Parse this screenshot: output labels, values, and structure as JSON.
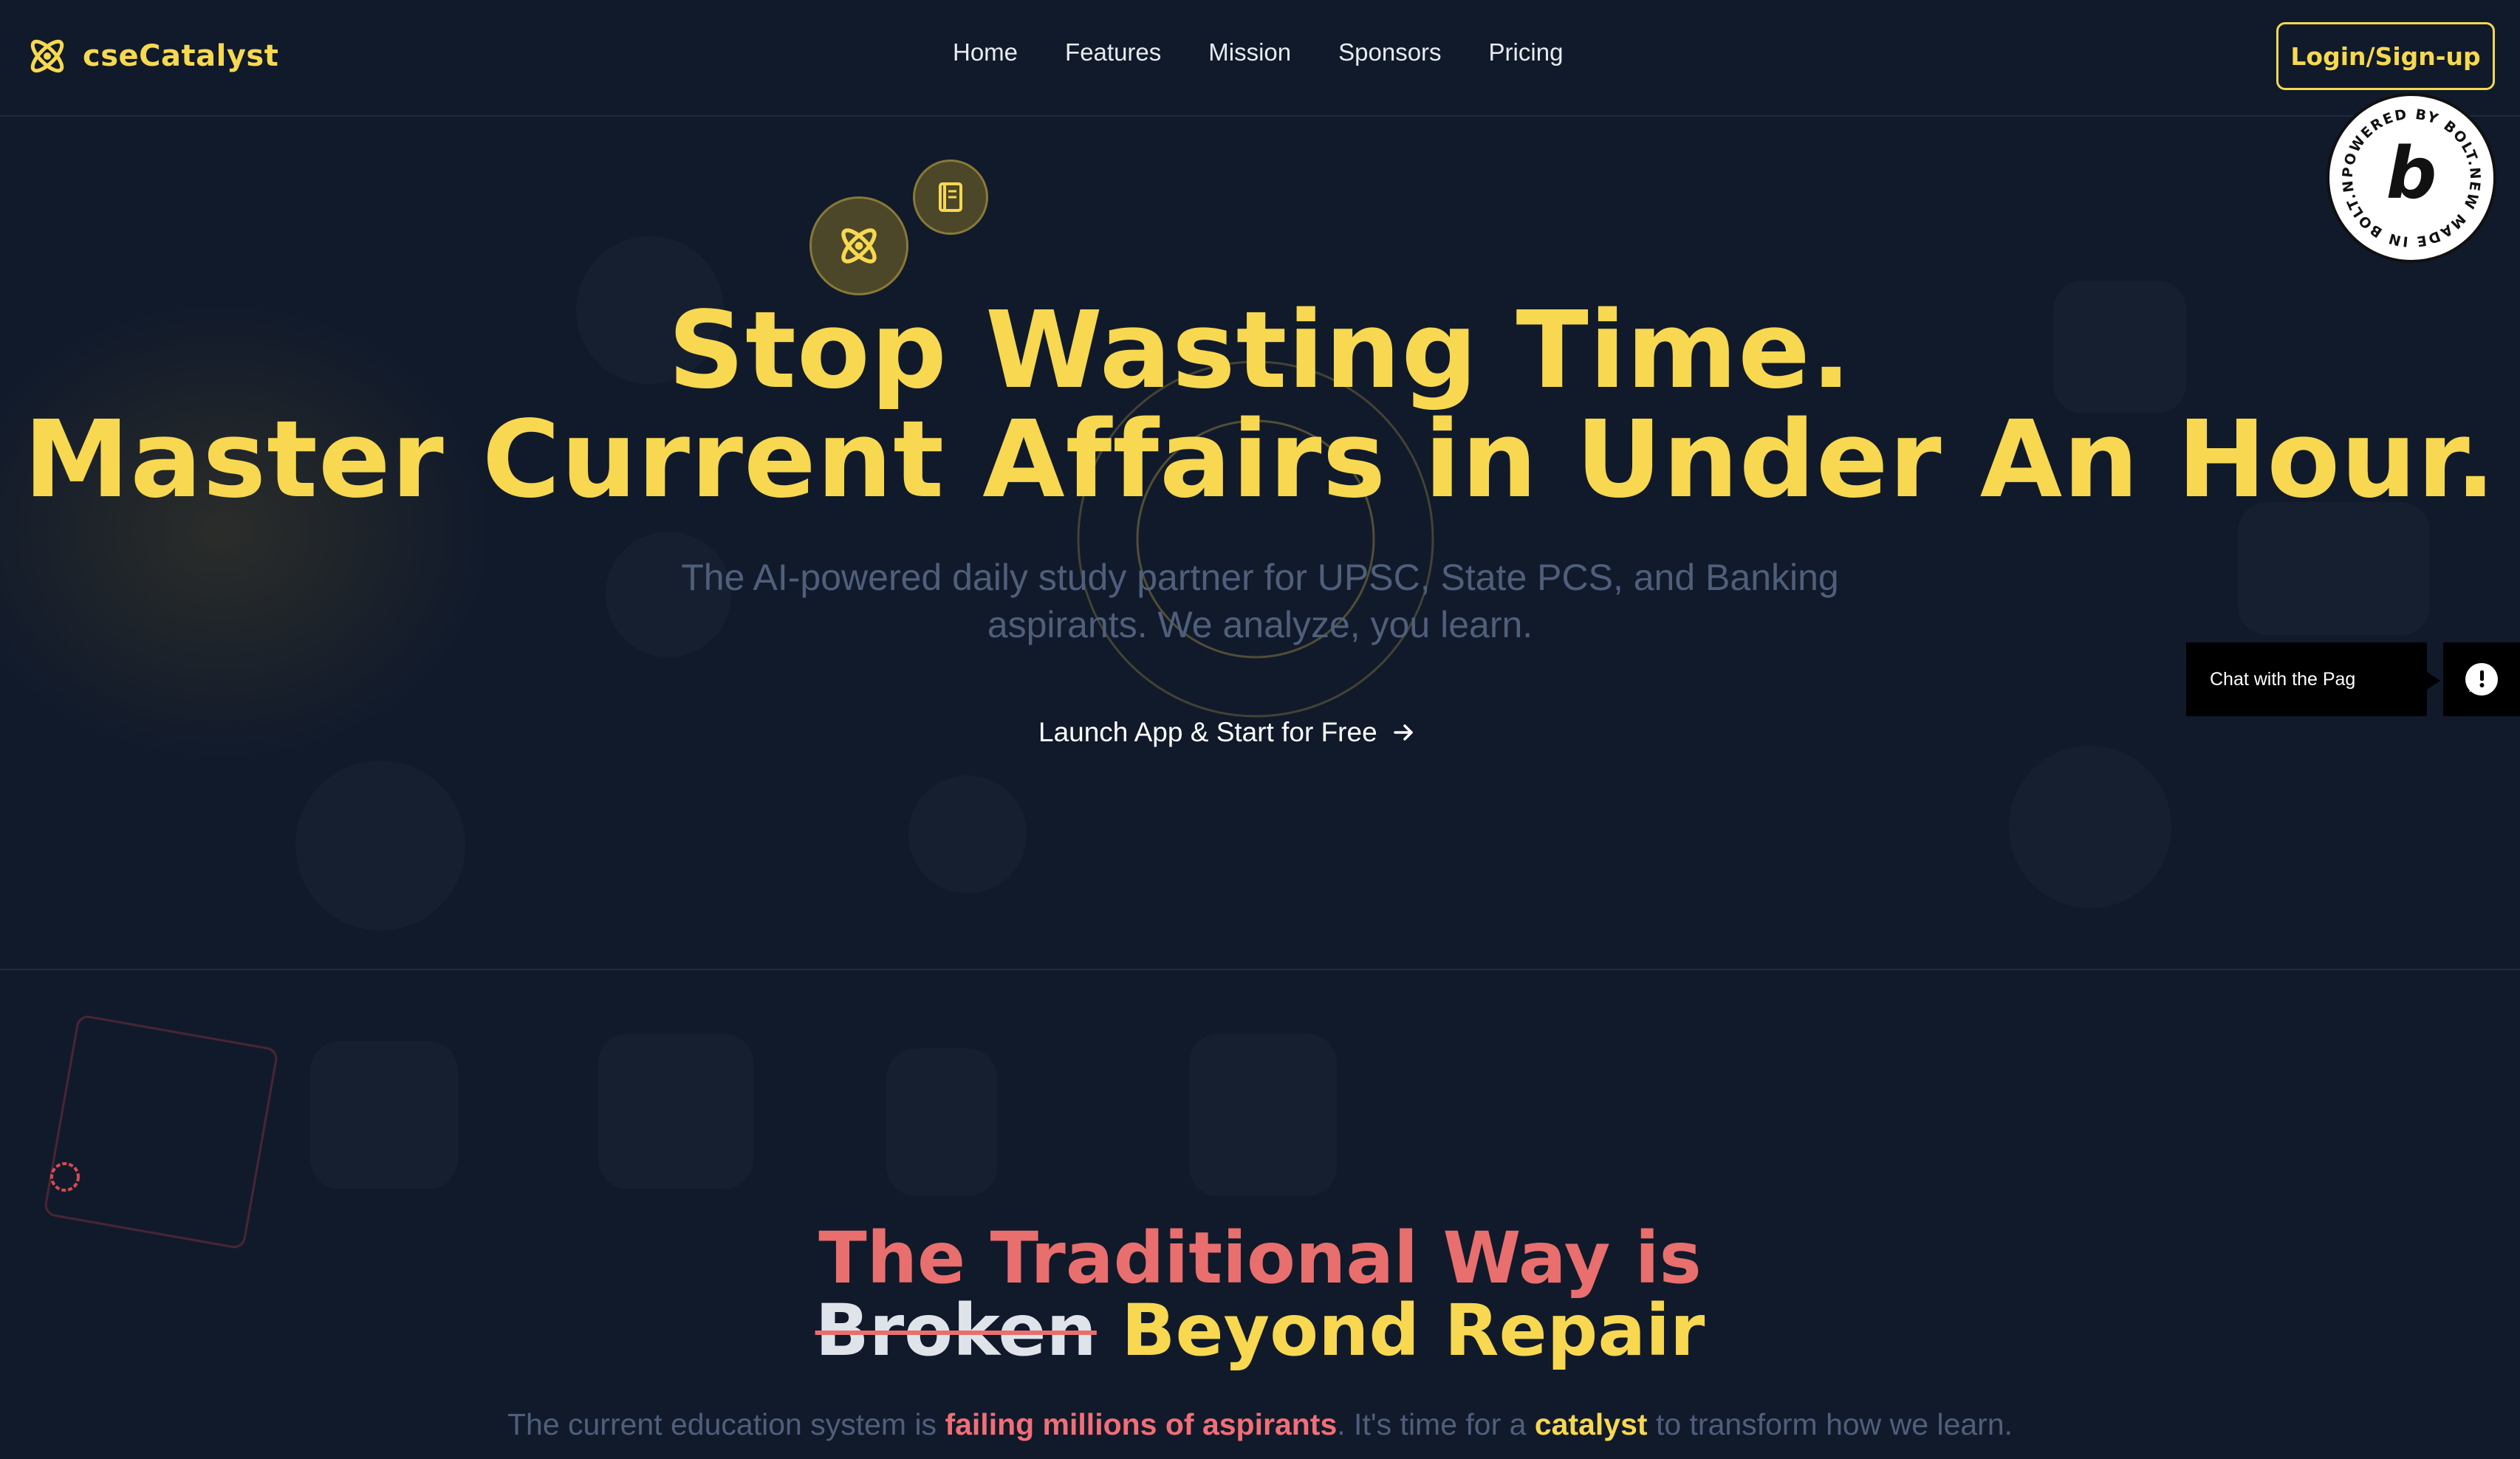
{
  "brand": {
    "name": "cseCatalyst",
    "logo_icon": "atom-icon"
  },
  "nav": {
    "links": [
      "Home",
      "Features",
      "Mission",
      "Sponsors",
      "Pricing"
    ],
    "login_label": "Login/Sign-up"
  },
  "badge": {
    "ring_text": "POWERED BY BOLT.NEW MADE IN BOLT.NEW ",
    "letter": "b"
  },
  "hero": {
    "title_line1": "Stop Wasting Time.",
    "title_line2": "Master Current Affairs in Under An Hour.",
    "subtitle": "The AI-powered daily study partner for UPSC, State PCS, and Banking aspirants. We analyze, you learn.",
    "cta_label": "Launch App & Start for Free",
    "cta_icon": "arrow-right-icon",
    "float_icons": [
      "atom-icon",
      "book-icon"
    ]
  },
  "chat": {
    "label": "Chat with the Pag",
    "icon": "chat-bubble-icon"
  },
  "section2": {
    "title_line1": "The Traditional Way is",
    "title_struck": "Broken",
    "title_rest": "Beyond Repair",
    "sub_prefix": "The current education system is ",
    "sub_highlight1": "failing millions of aspirants",
    "sub_middle": ". It's time for a ",
    "sub_highlight2": "catalyst",
    "sub_suffix": " to transform how we learn."
  },
  "colors": {
    "background": "#111a2b",
    "accent_yellow": "#f7d850",
    "accent_red": "#e86f6d",
    "muted_text": "#4f5f7b"
  }
}
